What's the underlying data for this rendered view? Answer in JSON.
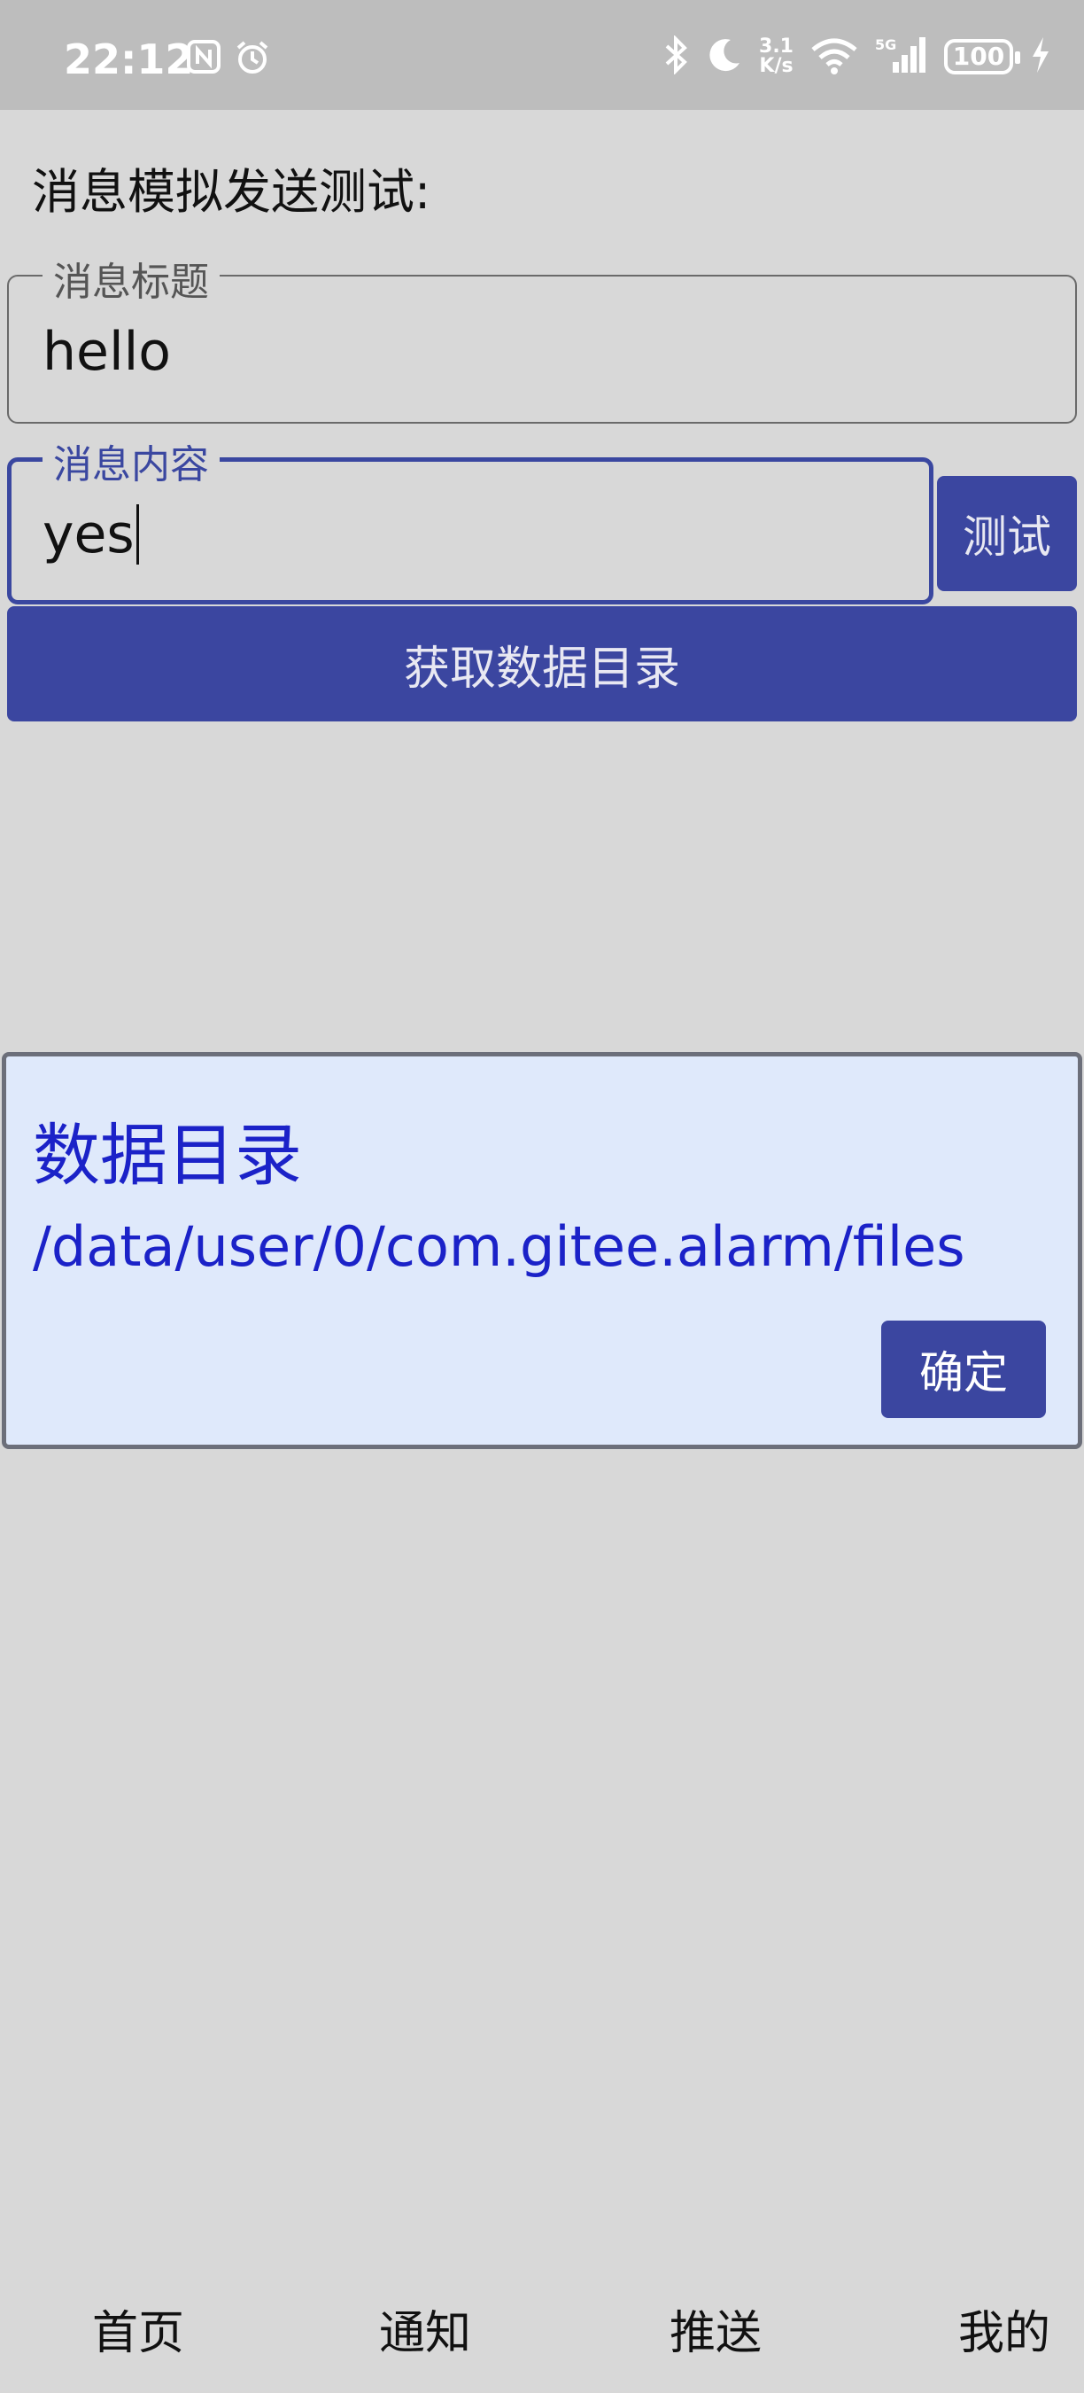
{
  "status_bar": {
    "time": "22:12",
    "net_speed_top": "3.1",
    "net_speed_bottom": "K/s",
    "battery": "100",
    "icons": [
      "nfc-icon",
      "alarm-icon",
      "bluetooth-icon",
      "moon-icon",
      "wifi-icon",
      "signal-icon",
      "charging-icon"
    ]
  },
  "page": {
    "title": "消息模拟发送测试:"
  },
  "form": {
    "title_field": {
      "label": "消息标题",
      "value": "hello"
    },
    "content_field": {
      "label": "消息内容",
      "value": "yes"
    },
    "test_button": "测试",
    "get_dir_button": "获取数据目录"
  },
  "dialog": {
    "title": "数据目录",
    "body": "/data/user/0/com.gitee.alarm/files",
    "ok_button": "确定"
  },
  "bottom_nav": {
    "items": [
      {
        "label": "首页"
      },
      {
        "label": "通知"
      },
      {
        "label": "推送"
      },
      {
        "label": "我的"
      }
    ]
  },
  "colors": {
    "accent": "#3b46a0",
    "dialog_bg": "#dfe9fb",
    "dialog_text": "#1b22c8",
    "page_bg": "#d8d8d8"
  }
}
